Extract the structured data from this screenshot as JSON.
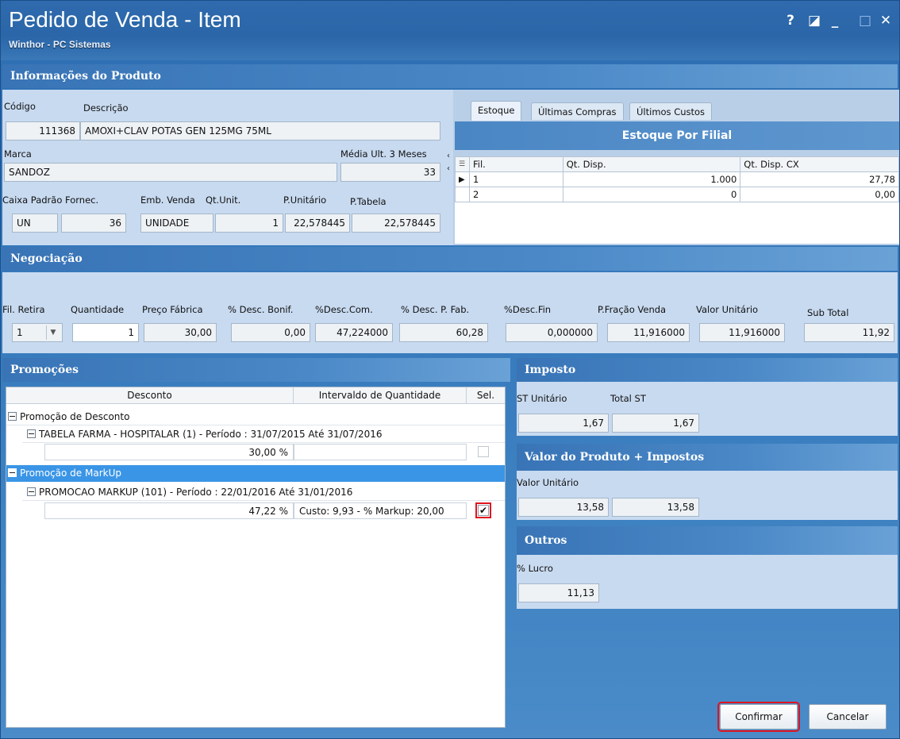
{
  "window": {
    "title": "Pedido de Venda - Item",
    "subtitle": "Winthor - PC Sistemas",
    "controls": [
      "?",
      "◪",
      "_",
      "□",
      "✕"
    ]
  },
  "produto": {
    "header": "Informações do Produto",
    "codigo_label": "Código",
    "descricao_label": "Descrição",
    "codigo": "111368",
    "descricao": "AMOXI+CLAV POTAS GEN 125MG 75ML",
    "marca_label": "Marca",
    "marca": "SANDOZ",
    "media_label": "Média Ult. 3 Meses",
    "media": "33",
    "caixa_label": "Caixa Padrão Fornec.",
    "caixa_un": "UN",
    "caixa_qt": "36",
    "emb_label": "Emb. Venda",
    "emb": "UNIDADE",
    "qtunit_label": "Qt.Unit.",
    "qtunit": "1",
    "punit_label": "P.Unitário",
    "punit": "22,578445",
    "ptab_label": "P.Tabela",
    "ptab": "22,578445"
  },
  "estoque": {
    "tabs": [
      "Estoque",
      "Últimas Compras",
      "Últimos Custos"
    ],
    "title": "Estoque Por Filial",
    "columns": [
      "Fil.",
      "Qt. Disp.",
      "Qt. Disp. CX"
    ],
    "rows": [
      {
        "fil": "1",
        "qt": "1.000",
        "cx": "27,78"
      },
      {
        "fil": "2",
        "qt": "0",
        "cx": "0,00"
      }
    ]
  },
  "negociacao": {
    "header": "Negociação",
    "labels": {
      "fil": "Fil. Retira",
      "qtd": "Quantidade",
      "pf": "Preço Fábrica",
      "bonif": "% Desc. Bonif.",
      "com": "%Desc.Com.",
      "pfab": "% Desc. P. Fab.",
      "fin": "%Desc.Fin",
      "frac": "P.Fração Venda",
      "vu": "Valor Unitário",
      "sub": "Sub Total"
    },
    "values": {
      "fil": "1",
      "qtd": "1",
      "pf": "30,00",
      "bonif": "0,00",
      "com": "47,224000",
      "pfab": "60,28",
      "fin": "0,000000",
      "frac": "11,916000",
      "vu": "11,916000",
      "sub": "11,92"
    }
  },
  "promocoes": {
    "header": "Promoções",
    "columns": [
      "Desconto",
      "Intervaldo de Quantidade",
      "Sel."
    ],
    "group1": "Promoção de Desconto",
    "group1_item": "TABELA FARMA - HOSPITALAR (1) - Período : 31/07/2015 Até 31/07/2016",
    "group1_value": "30,00 %",
    "group2": "Promoção de MarkUp",
    "group2_item": "PROMOCAO MARKUP (101) - Período : 22/01/2016 Até 31/01/2016",
    "group2_value": "47,22 %",
    "group2_interval": "Custo: 9,93 - % Markup: 20,00",
    "check_mark": "✔"
  },
  "imposto": {
    "header": "Imposto",
    "st_unit_label": "ST Unitário",
    "st_total_label": "Total ST",
    "st_unit": "1,67",
    "st_total": "1,67"
  },
  "valor_produto": {
    "header": "Valor do Produto + Impostos",
    "label": "Valor Unitário",
    "v1": "13,58",
    "v2": "13,58"
  },
  "outros": {
    "header": "Outros",
    "lucro_label": "% Lucro",
    "lucro": "11,13"
  },
  "buttons": {
    "confirmar": "Confirmar",
    "cancelar": "Cancelar"
  },
  "colors": {
    "title_bar": "#2e6aad",
    "panel": "#c8daf0",
    "selected_row": "#3a95e6",
    "highlight": "#e0141e"
  }
}
